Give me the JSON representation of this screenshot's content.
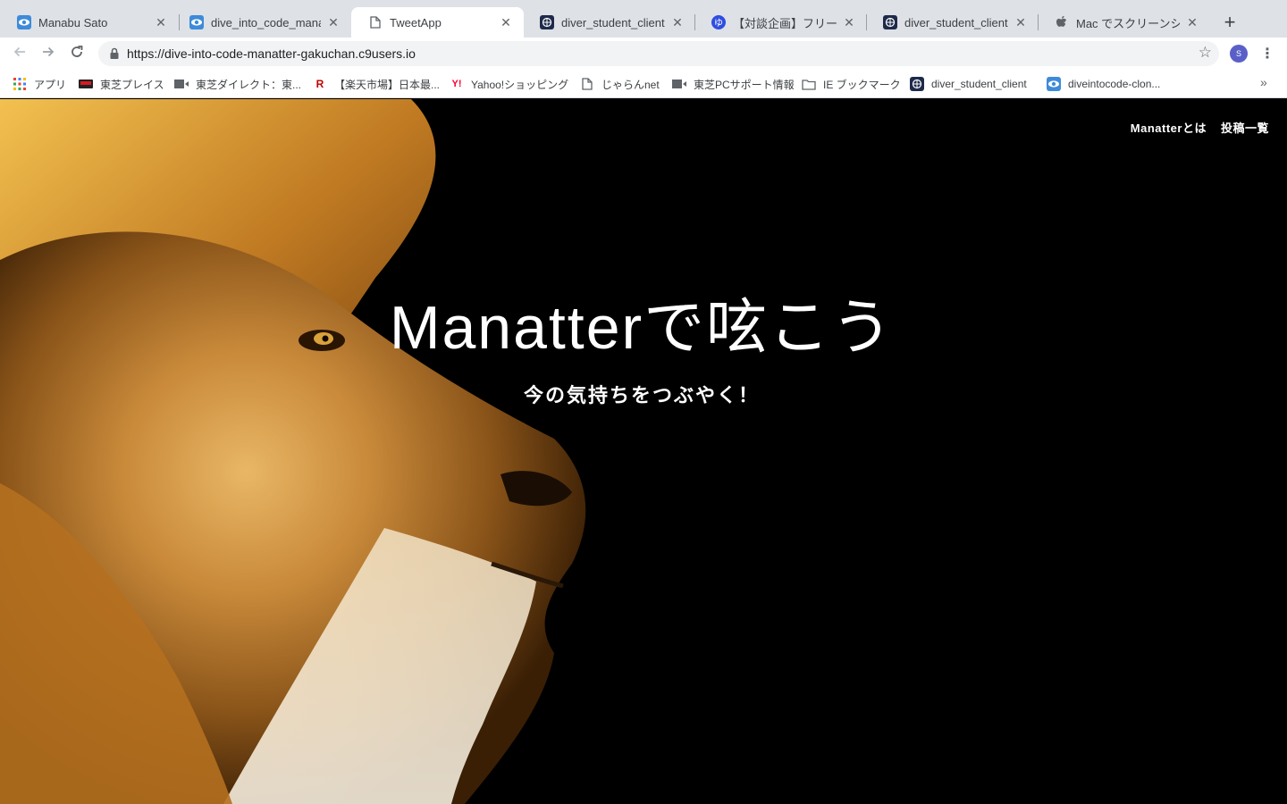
{
  "browser": {
    "tabs": [
      {
        "title": "Manabu Sato",
        "icon": "diveintocode-eye-icon",
        "active": false
      },
      {
        "title": "dive_into_code_manatter",
        "icon": "diveintocode-eye-icon",
        "active": false
      },
      {
        "title": "TweetApp",
        "icon": "document-icon",
        "active": true
      },
      {
        "title": "diver_student_client",
        "icon": "globe-icon",
        "active": false
      },
      {
        "title": "【対談企画】フリーランス",
        "icon": "letter-circle-icon",
        "active": false
      },
      {
        "title": "diver_student_client",
        "icon": "globe-icon",
        "active": false
      },
      {
        "title": "Mac でスクリーンショット",
        "icon": "apple-icon",
        "active": false
      }
    ],
    "url": "https://dive-into-code-manatter-gakuchan.c9users.io",
    "avatar_initial": "S",
    "bookmarks": [
      {
        "label": "アプリ",
        "icon": "apps-grid-icon"
      },
      {
        "label": "東芝プレイス",
        "icon": "toshiba-icon"
      },
      {
        "label": "東芝ダイレクト：東...",
        "icon": "bookmark-icon"
      },
      {
        "label": "【楽天市場】日本最...",
        "icon": "rakuten-icon"
      },
      {
        "label": "Yahoo!ショッピング",
        "icon": "yahoo-icon"
      },
      {
        "label": "じゃらんnet",
        "icon": "document-icon"
      },
      {
        "label": "東芝PCサポート情報",
        "icon": "bookmark-icon"
      },
      {
        "label": "IE ブックマーク",
        "icon": "folder-icon"
      },
      {
        "label": "diver_student_client",
        "icon": "globe-icon"
      },
      {
        "label": "diveintocode-clon...",
        "icon": "diveintocode-eye-icon"
      }
    ],
    "colors": {
      "tabstrip": "#dee1e6",
      "omnibox": "#f1f3f4",
      "avatar": "#5a5fc8"
    }
  },
  "site": {
    "nav": [
      {
        "label": "Manatterとは"
      },
      {
        "label": "投稿一覧"
      }
    ],
    "hero": {
      "title": "Manatterで呟こう",
      "subtitle": "今の気持ちをつぶやく！",
      "background": "lion-photo"
    }
  }
}
